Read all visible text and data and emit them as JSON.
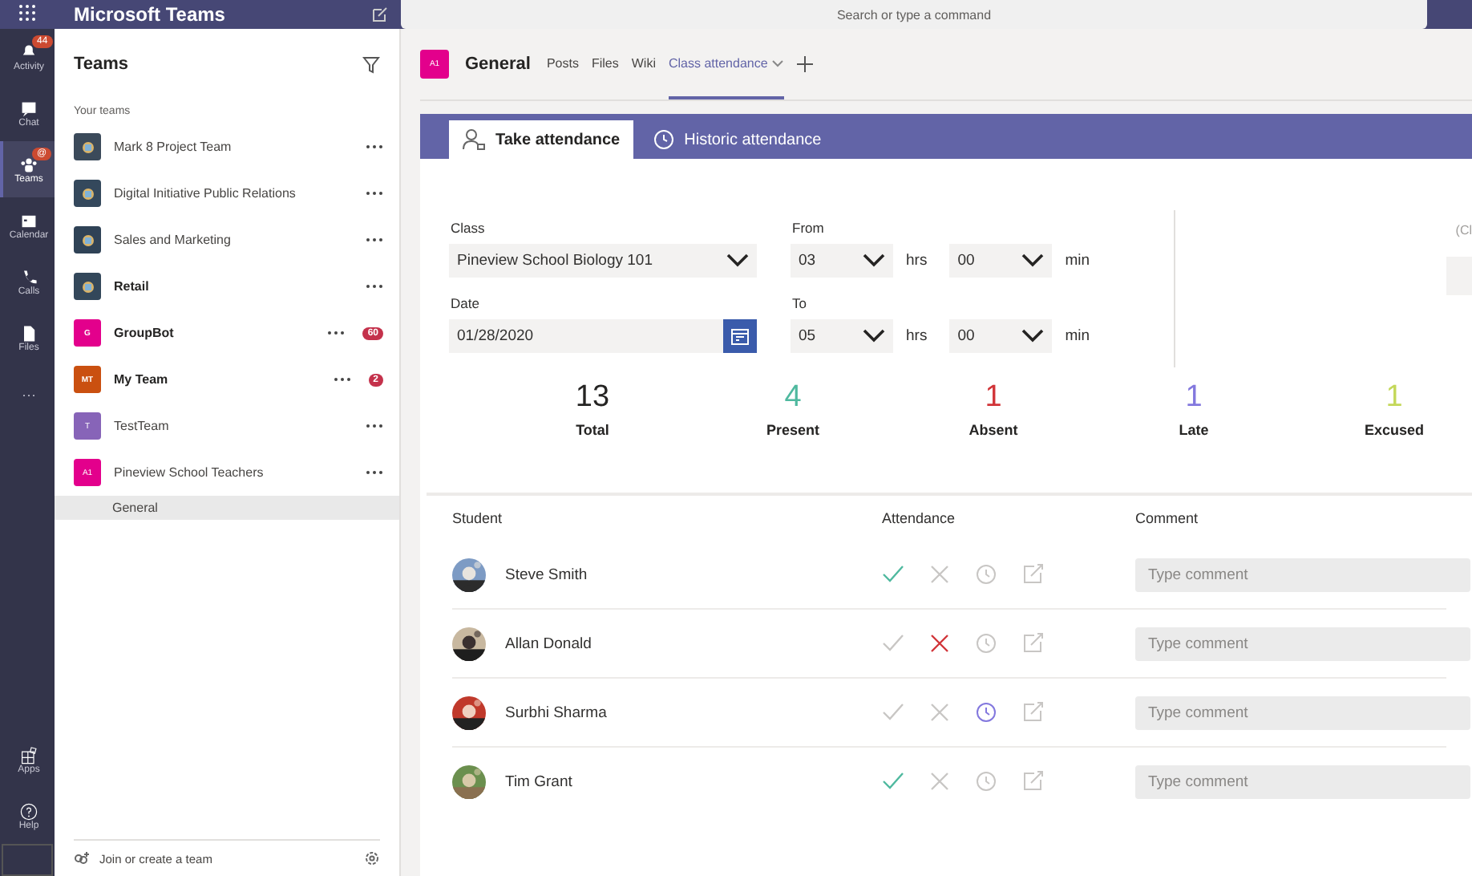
{
  "app_title": "Microsoft Teams",
  "search": {
    "placeholder": "Search or type a command"
  },
  "rail": [
    {
      "label": "Activity",
      "badge": "44",
      "selected": false
    },
    {
      "label": "Chat",
      "selected": false
    },
    {
      "label": "Teams",
      "badge": "@",
      "selected": true
    },
    {
      "label": "Calendar",
      "selected": false
    },
    {
      "label": "Calls",
      "selected": false
    },
    {
      "label": "Files",
      "selected": false
    },
    {
      "label": "···",
      "selected": false
    }
  ],
  "rail_bottom": [
    {
      "label": "Apps"
    },
    {
      "label": "Help"
    }
  ],
  "teams_panel": {
    "title": "Teams",
    "section": "Your teams",
    "teams": [
      {
        "name": "Mark 8 Project Team",
        "color": "#3b4a5a",
        "unread": false
      },
      {
        "name": "Digital Initiative Public Relations",
        "color": "#34485c",
        "unread": false
      },
      {
        "name": "Sales and Marketing",
        "color": "#2f4256",
        "unread": false
      },
      {
        "name": "Retail",
        "color": "#33475a",
        "unread": true
      },
      {
        "name": "GroupBot",
        "kind": "initials",
        "initials": "G",
        "color": "#e3008c",
        "unread": true,
        "badge": "60"
      },
      {
        "name": "My Team",
        "kind": "initials",
        "initials": "MT",
        "color": "#ca5010",
        "unread": true,
        "badge": "2"
      },
      {
        "name": "TestTeam",
        "kind": "initials",
        "initials": "T",
        "color": "#8764b8",
        "unread": false
      },
      {
        "name": "Pineview School Teachers",
        "kind": "initials",
        "initials": "A1",
        "color": "#e3008c",
        "unread": false,
        "channels": [
          {
            "name": "General",
            "selected": true
          }
        ]
      }
    ],
    "footer": "Join or create a team"
  },
  "channel": {
    "initials": "A1",
    "name": "General",
    "tabs": [
      {
        "label": "Posts",
        "selected": false
      },
      {
        "label": "Files",
        "selected": false
      },
      {
        "label": "Wiki",
        "selected": false
      },
      {
        "label": "Class attendance",
        "selected": true
      }
    ]
  },
  "mode_tabs": [
    {
      "label": "Take attendance",
      "selected": true
    },
    {
      "label": "Historic attendance",
      "selected": false
    }
  ],
  "form": {
    "class_label": "Class",
    "class_value": "Pineview School Biology 101",
    "date_label": "Date",
    "date_value": "01/28/2020",
    "from_label": "From",
    "from_hrs": "03",
    "from_hrs_unit": "hrs",
    "from_min": "00",
    "from_min_unit": "min",
    "to_label": "To",
    "to_hrs": "05",
    "to_hrs_unit": "hrs",
    "to_min": "00",
    "to_min_unit": "min",
    "side_note": "(Cl"
  },
  "stats": [
    {
      "value": "13",
      "label": "Total",
      "color": "#252423"
    },
    {
      "value": "4",
      "label": "Present",
      "color": "#4fb99f"
    },
    {
      "value": "1",
      "label": "Absent",
      "color": "#d13438"
    },
    {
      "value": "1",
      "label": "Late",
      "color": "#8378de"
    },
    {
      "value": "1",
      "label": "Excused",
      "color": "#c4d85a"
    }
  ],
  "table": {
    "columns": [
      "Student",
      "Attendance",
      "Comment"
    ],
    "rows": [
      {
        "name": "Steve Smith",
        "present": true,
        "absent": false,
        "late": false,
        "excused": false,
        "comment_placeholder": "Type comment"
      },
      {
        "name": "Allan Donald",
        "present": false,
        "absent": true,
        "late": false,
        "excused": false,
        "comment_placeholder": "Type comment"
      },
      {
        "name": "Surbhi Sharma",
        "present": false,
        "absent": false,
        "late": true,
        "excused": false,
        "comment_placeholder": "Type comment"
      },
      {
        "name": "Tim Grant",
        "present": true,
        "absent": false,
        "late": false,
        "excused": false,
        "comment_placeholder": "Type comment"
      }
    ]
  }
}
